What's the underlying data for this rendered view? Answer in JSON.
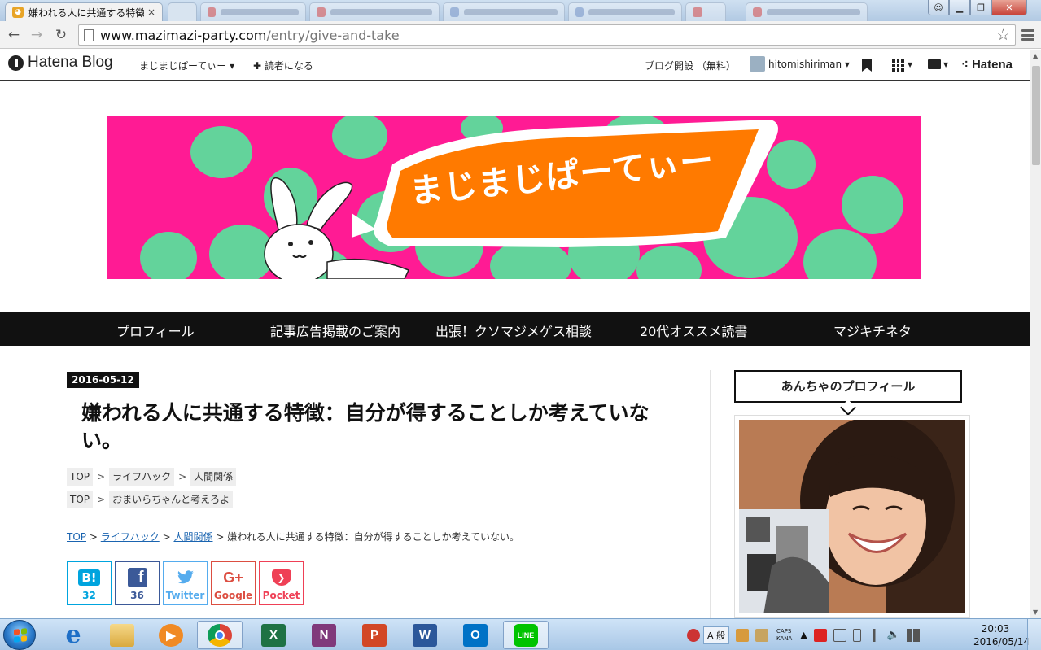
{
  "browser": {
    "tab_title": "嫌われる人に共通する特徴",
    "tab_close": "×",
    "url_host": "www.mazimazi-party.com",
    "url_path": "/entry/give-and-take"
  },
  "hatena_bar": {
    "logo": "Hatena Blog",
    "blog_name": "まじまじぱーてぃー ▾",
    "subscribe": "✚ 読者になる",
    "open_blog": "ブログ開設 （無料）",
    "username": "hitomishiriman ▾",
    "brand": "⁖ Hatena"
  },
  "banner": {
    "title": "まじまじぱーてぃー"
  },
  "global_nav": [
    {
      "label": "プロフィール"
    },
    {
      "label": "記事広告掲載のご案内"
    },
    {
      "label": "出張！クソマジメゲス相談"
    },
    {
      "label": "20代オススメ読書"
    },
    {
      "label": "マジキチネタ"
    }
  ],
  "article": {
    "date": "2016-05-12",
    "title": "嫌われる人に共通する特徴：自分が得することしか考えていない。",
    "category_rows": [
      {
        "top": "TOP",
        "cats": [
          "ライフハック",
          "人間関係"
        ]
      },
      {
        "top": "TOP",
        "cats": [
          "おまいらちゃんと考えろよ"
        ]
      }
    ],
    "breadcrumb": {
      "top": "TOP",
      "life": "ライフハック",
      "human": "人間関係",
      "current": "嫌われる人に共通する特徴：自分が得することしか考えていない。",
      "sep": ">"
    }
  },
  "share": {
    "hatena": {
      "icon": "B!",
      "count": "32"
    },
    "facebook": {
      "count": "36"
    },
    "twitter": {
      "label": "Twitter"
    },
    "google": {
      "icon": "G+",
      "label": "Google"
    },
    "pocket": {
      "label": "Pocket"
    }
  },
  "sidebar": {
    "profile_heading": "あんちゃのプロフィール"
  },
  "taskbar": {
    "ime": "A 般",
    "caps": "CAPS",
    "kana": "KANA",
    "time": "20:03",
    "date": "2016/05/14"
  },
  "colors": {
    "banner_pink": "#ff1b94",
    "banner_orange": "#ff7a00",
    "banner_green": "#63d39b",
    "hatena_blue": "#00a4de",
    "facebook": "#3b5998",
    "twitter": "#55acee",
    "google": "#dc4e41",
    "pocket": "#ef4056"
  }
}
